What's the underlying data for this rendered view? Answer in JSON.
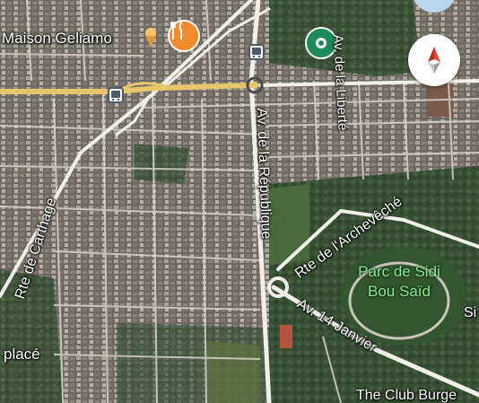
{
  "places": {
    "maison": "Maison Geliamo",
    "park_line1": "Parc de Sidi",
    "park_line2": "Bou Saïd",
    "club": "The Club Burge",
    "place": "placé",
    "side_letter": "Si"
  },
  "roads": {
    "liberte": "Av. de la Liberté",
    "republique": "Av. de la République",
    "carthage": "Rte de Carthage",
    "archeveche": "Rte de l'Archevêché",
    "janvier": "Av. 14 Janvier"
  },
  "icons": {
    "restaurant": "restaurant-icon",
    "ice_cream": "ice-cream-icon",
    "bus": "bus-stop-icon",
    "place_pin": "place-pin-icon",
    "compass": "compass-icon"
  },
  "colors": {
    "restaurant": "#f28b2e",
    "place_pin": "#1e8a5a",
    "highway": "#e8c46a",
    "park_label": "#8fe39a",
    "compass_red": "#e24a33"
  }
}
